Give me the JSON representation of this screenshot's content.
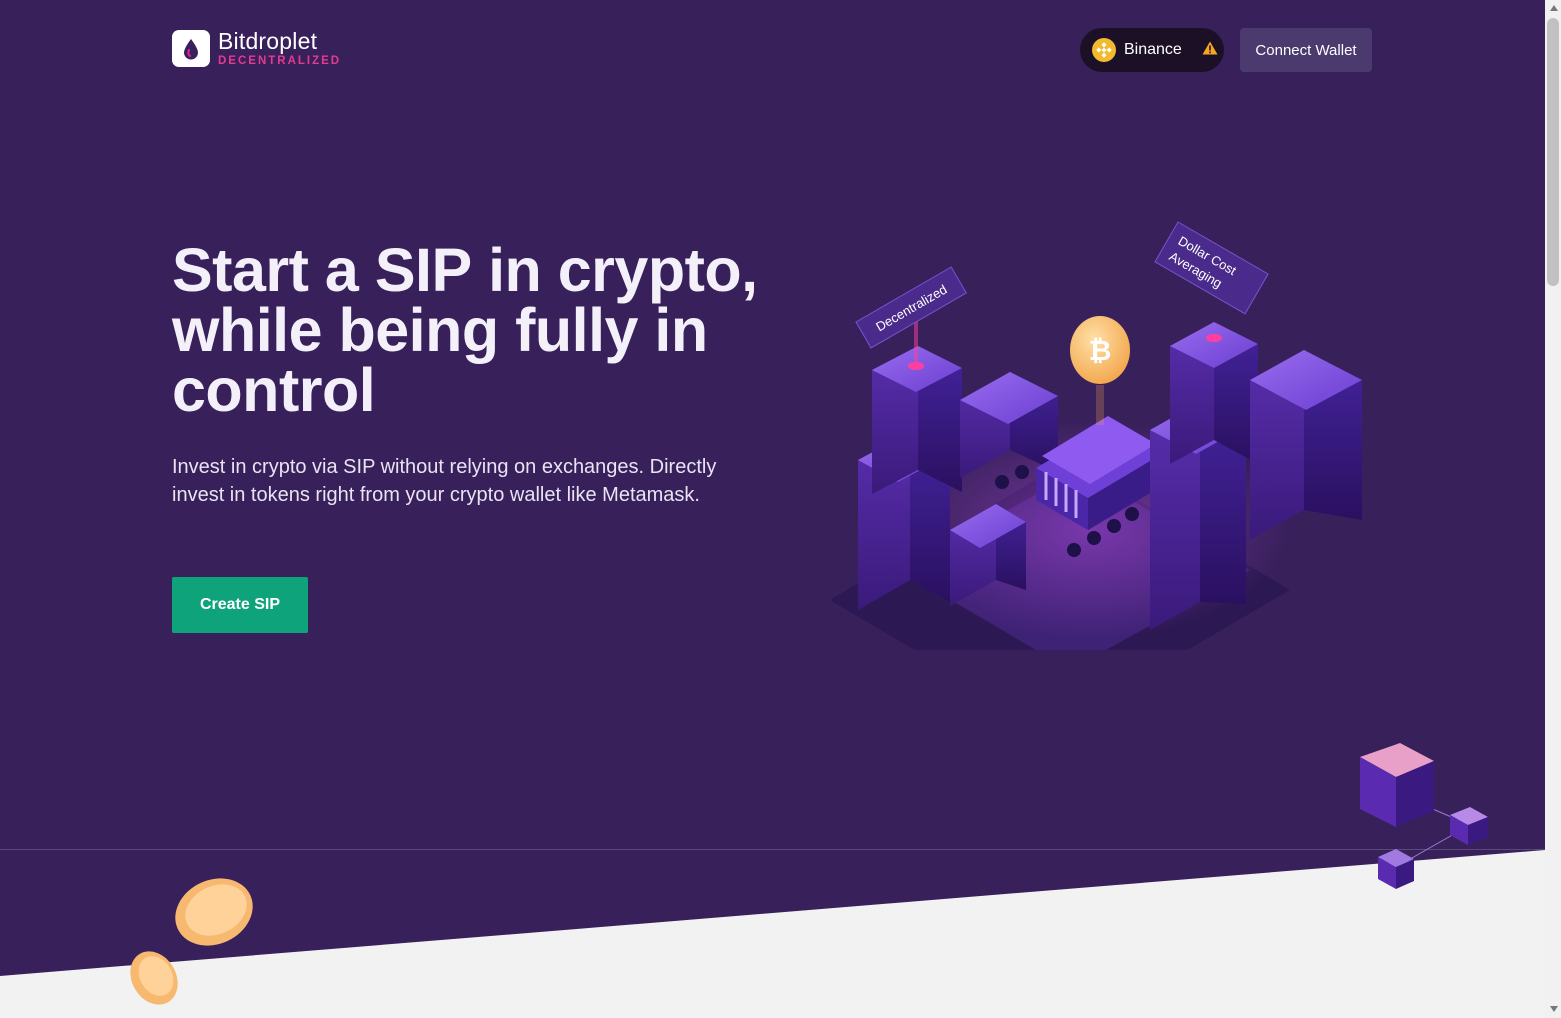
{
  "header": {
    "brand_name": "Bitdroplet",
    "brand_sub": "DECENTRALIZED",
    "network_label": "Binance",
    "connect_label": "Connect Wallet"
  },
  "hero": {
    "headline_pre": "Start a ",
    "headline_highlight": "SIP",
    "headline_post": " in crypto, while being fully in control",
    "subtext": "Invest in crypto via SIP without relying on exchanges. Directly invest in tokens right from your crypto wallet like Metamask.",
    "cta_label": "Create SIP"
  },
  "illustration": {
    "sign_left": "Decentralized",
    "sign_right_line1": "Dollar Cost",
    "sign_right_line2": "Averaging"
  },
  "colors": {
    "background": "#38205b",
    "accent_pink": "#e6268c",
    "cta_green": "#0fa37c",
    "connect_bg": "#4b3a6e",
    "pill_bg": "#1b1026"
  },
  "icons": [
    "droplet-logo-icon",
    "binance-coin-icon",
    "warning-icon",
    "bitcoin-coin-icon"
  ]
}
